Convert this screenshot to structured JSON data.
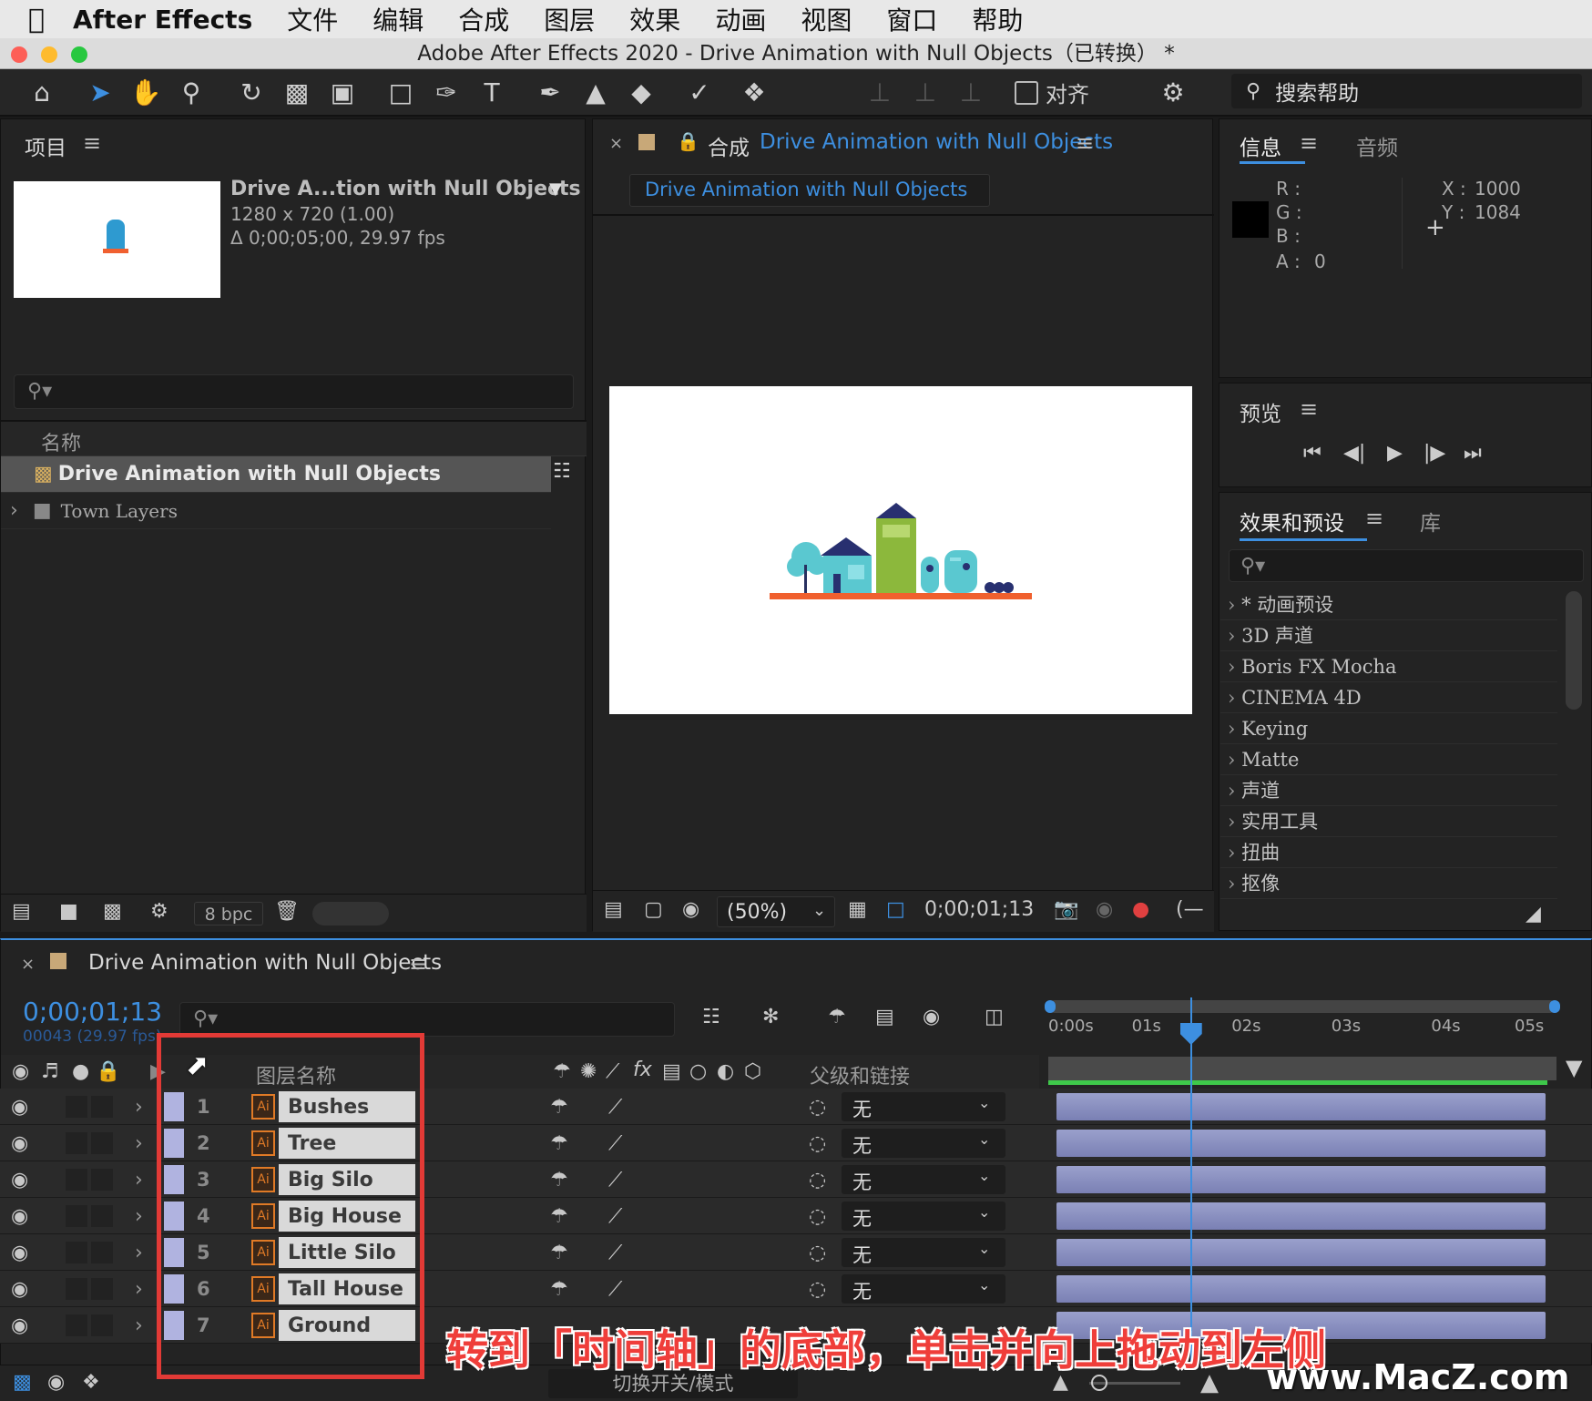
{
  "menubar": {
    "app": "After Effects",
    "items": [
      "文件",
      "编辑",
      "合成",
      "图层",
      "效果",
      "动画",
      "视图",
      "窗口",
      "帮助"
    ]
  },
  "window": {
    "title": "Adobe After Effects 2020 - Drive Animation with Null Objects（已转换） *"
  },
  "toolbar": {
    "align_label": "对齐",
    "search_placeholder": "搜索帮助"
  },
  "project": {
    "tab": "项目",
    "comp_name": "Drive A...tion with Null Objects",
    "comp_size": "1280 x 720 (1.00)",
    "comp_duration": "Δ 0;00;05;00, 29.97 fps",
    "col_name": "名称",
    "items": [
      {
        "name": "Drive Animation with Null Objects",
        "type": "composition",
        "selected": true
      },
      {
        "name": "Town Layers",
        "type": "folder",
        "selected": false
      }
    ],
    "bpc": "8 bpc"
  },
  "composition": {
    "tab_prefix": "合成",
    "tab_name": "Drive Animation with Null Objects",
    "breadcrumb": "Drive Animation with Null Objects",
    "zoom": "(50%)",
    "timecode": "0;00;01;13"
  },
  "info": {
    "tab": "信息",
    "tab2": "音频",
    "r_label": "R :",
    "g_label": "G :",
    "b_label": "B :",
    "a_label": "A :",
    "a_value": "0",
    "x_label": "X :",
    "x_value": "1000",
    "y_label": "Y :",
    "y_value": "1084"
  },
  "preview": {
    "tab": "预览"
  },
  "effects": {
    "tab": "效果和预设",
    "tab2": "库",
    "items": [
      "* 动画预设",
      "3D 声道",
      "Boris FX Mocha",
      "CINEMA 4D",
      "Keying",
      "Matte",
      "声道",
      "实用工具",
      "扭曲",
      "抠像"
    ]
  },
  "timeline": {
    "tab": "Drive Animation with Null Objects",
    "timecode": "0;00;01;13",
    "frame_info": "00043 (29.97 fps)",
    "col_layer_name": "图层名称",
    "col_parent": "父级和链接",
    "parent_value": "无",
    "ruler": [
      "0:00s",
      "01s",
      "02s",
      "03s",
      "04s",
      "05s"
    ],
    "playhead_seconds": 1.43,
    "duration_seconds": 5,
    "layers": [
      {
        "num": "1",
        "name": "Bushes"
      },
      {
        "num": "2",
        "name": "Tree"
      },
      {
        "num": "3",
        "name": "Big Silo"
      },
      {
        "num": "4",
        "name": "Big House"
      },
      {
        "num": "5",
        "name": "Little Silo"
      },
      {
        "num": "6",
        "name": "Tall House"
      },
      {
        "num": "7",
        "name": "Ground"
      }
    ],
    "footer_toggle": "切换开关/模式"
  },
  "overlay": {
    "caption": "转到「时间轴」的底部，单击并向上拖动到左侧",
    "watermark": "www.MacZ.com"
  },
  "colors": {
    "accent": "#3d8fe0",
    "highlight_box": "#e23a36",
    "track_bar": "#8a8fc2",
    "work_area": "#3ec84a"
  }
}
